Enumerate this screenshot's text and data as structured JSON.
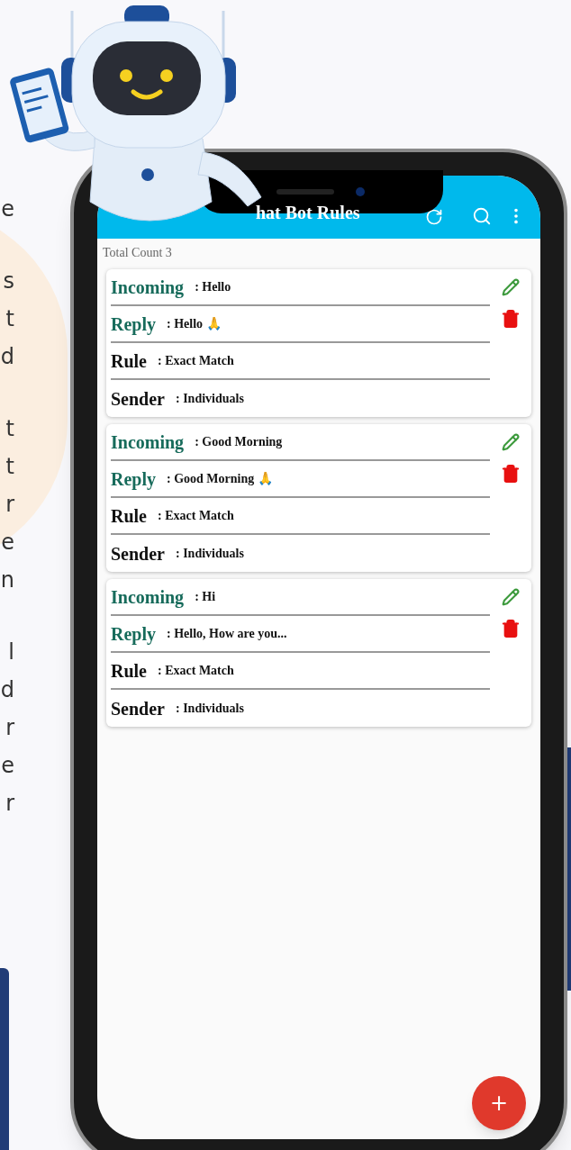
{
  "side_text": {
    "paragraphs": [
      [
        "e"
      ],
      [
        "s",
        "t",
        "d"
      ],
      [
        "t",
        "t",
        "r",
        "e",
        "n"
      ],
      [
        "l",
        "d",
        "r",
        "e",
        "r"
      ]
    ]
  },
  "app_bar": {
    "title": "hat Bot Rules"
  },
  "total_count": "Total Count 3",
  "rules": [
    {
      "fields": [
        {
          "label": "Incoming",
          "value": ": Hello",
          "accent": true
        },
        {
          "label": "Reply",
          "value": ": Hello 🙏",
          "accent": true
        },
        {
          "label": "Rule",
          "value": ": Exact Match",
          "accent": false
        },
        {
          "label": "Sender",
          "value": ": Individuals",
          "accent": false
        }
      ]
    },
    {
      "fields": [
        {
          "label": "Incoming",
          "value": ": Good Morning",
          "accent": true
        },
        {
          "label": "Reply",
          "value": ": Good Morning 🙏",
          "accent": true
        },
        {
          "label": "Rule",
          "value": ": Exact Match",
          "accent": false
        },
        {
          "label": "Sender",
          "value": ": Individuals",
          "accent": false
        }
      ]
    },
    {
      "fields": [
        {
          "label": "Incoming",
          "value": ": Hi",
          "accent": true
        },
        {
          "label": "Reply",
          "value": ": Hello, How are you...",
          "accent": true
        },
        {
          "label": "Rule",
          "value": ": Exact Match",
          "accent": false
        },
        {
          "label": "Sender",
          "value": ": Individuals",
          "accent": false
        }
      ]
    }
  ],
  "fab": {
    "label": "+"
  }
}
